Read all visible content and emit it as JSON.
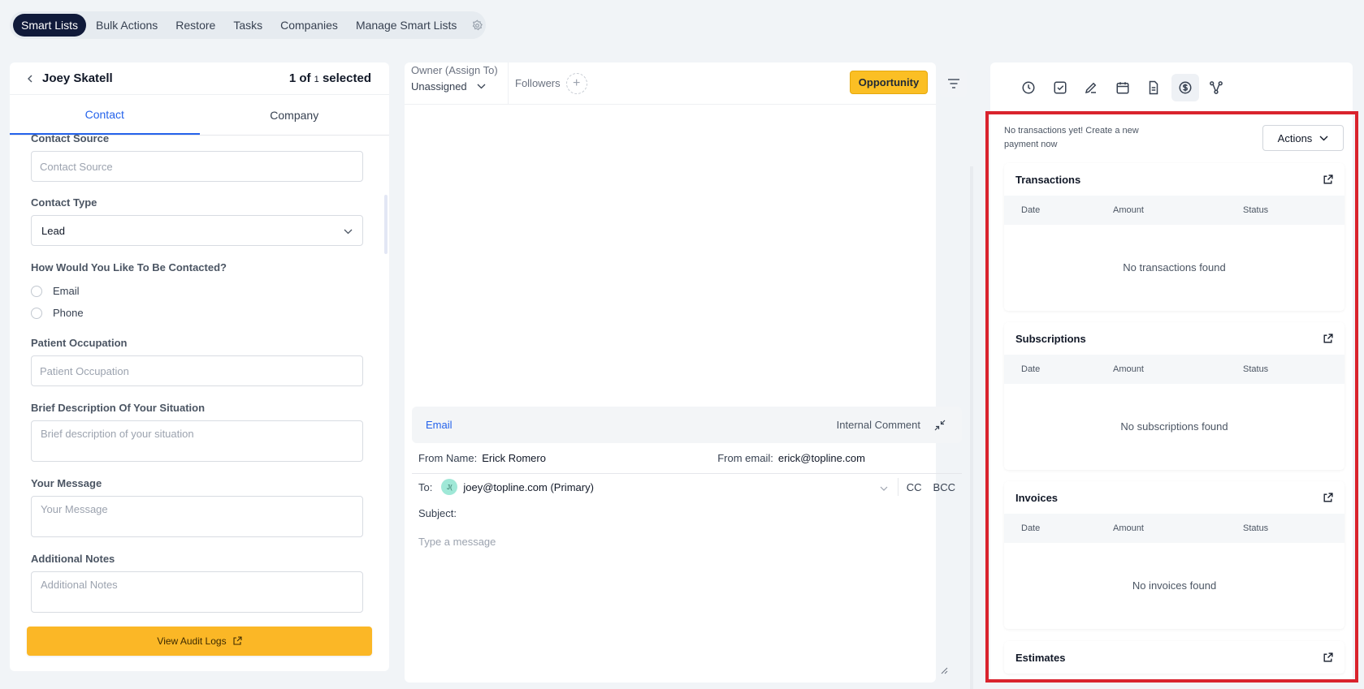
{
  "topnav": {
    "tabs": [
      "Smart Lists",
      "Bulk Actions",
      "Restore",
      "Tasks",
      "Companies",
      "Manage Smart Lists"
    ]
  },
  "contact_panel": {
    "name": "Joey Skatell",
    "selection": {
      "prefix": "1 of",
      "count": "1",
      "suffix": "selected"
    },
    "tabs": {
      "contact": "Contact",
      "company": "Company"
    },
    "contact_source": {
      "label": "Contact Source",
      "placeholder": "Contact Source"
    },
    "contact_type": {
      "label": "Contact Type",
      "value": "Lead"
    },
    "contact_method": {
      "label": "How Would You Like To Be Contacted?",
      "options": [
        "Email",
        "Phone"
      ]
    },
    "patient_occupation": {
      "label": "Patient Occupation",
      "placeholder": "Patient Occupation"
    },
    "brief_description": {
      "label": "Brief Description Of Your Situation",
      "placeholder": "Brief description of your situation"
    },
    "your_message": {
      "label": "Your Message",
      "placeholder": "Your Message"
    },
    "additional_notes": {
      "label": "Additional Notes",
      "placeholder": "Additional Notes"
    },
    "audit_button": "View Audit Logs"
  },
  "conversation": {
    "owner_label": "Owner (Assign To)",
    "owner_value": "Unassigned",
    "followers_label": "Followers",
    "opportunity_button": "Opportunity",
    "composer": {
      "tab_email": "Email",
      "tab_internal": "Internal Comment",
      "from_name_label": "From Name:",
      "from_name_value": "Erick Romero",
      "from_email_label": "From email:",
      "from_email_value": "erick@topline.com",
      "to_label": "To:",
      "to_avatar": "J(",
      "to_value": "joey@topline.com (Primary)",
      "cc": "CC",
      "bcc": "BCC",
      "subject_label": "Subject:",
      "message_placeholder": "Type a message"
    }
  },
  "payments": {
    "note": "No transactions yet! Create a new payment now",
    "actions_button": "Actions",
    "columns": [
      "Date",
      "Amount",
      "Status"
    ],
    "cards": [
      {
        "title": "Transactions",
        "empty": "No transactions found"
      },
      {
        "title": "Subscriptions",
        "empty": "No subscriptions found"
      },
      {
        "title": "Invoices",
        "empty": "No invoices found"
      },
      {
        "title": "Estimates"
      }
    ],
    "highlight_color": "#d9232d"
  },
  "colors": {
    "accent": "#2563eb",
    "brand_yellow": "#fbbf24",
    "nav_active": "#101a3a"
  }
}
